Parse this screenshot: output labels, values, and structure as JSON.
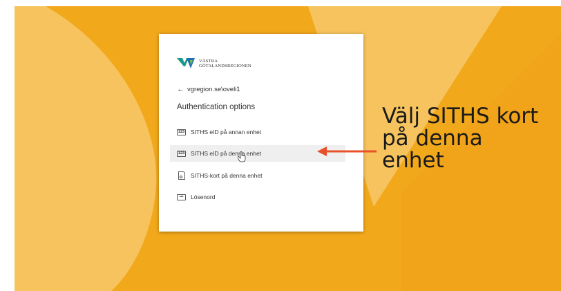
{
  "colors": {
    "background": "#f2a81b",
    "card": "#ffffff",
    "accent_arrow": "#e8502a",
    "logo_teal": "#1a9a8a"
  },
  "logo": {
    "line1": "VÄSTRA",
    "line2": "GÖTALANDSREGIONEN",
    "icon": "vgr-logo-icon"
  },
  "account": {
    "back_icon": "back-arrow-icon",
    "username": "vgregion.se\\oveli1"
  },
  "heading": "Authentication options",
  "options": [
    {
      "icon": "number-pad-icon",
      "icon_text": "123",
      "label": "SITHS eID på annan enhet"
    },
    {
      "icon": "number-pad-icon",
      "icon_text": "123",
      "label": "SITHS eID på denna enhet"
    },
    {
      "icon": "smartcard-document-icon",
      "icon_text": "",
      "label": "SITHS-kort på denna enhet"
    },
    {
      "icon": "password-dots-icon",
      "icon_text": "•••",
      "label": "Lösenord"
    }
  ],
  "callout": {
    "lines": [
      "Välj SITHS kort",
      "på denna",
      "enhet"
    ]
  }
}
